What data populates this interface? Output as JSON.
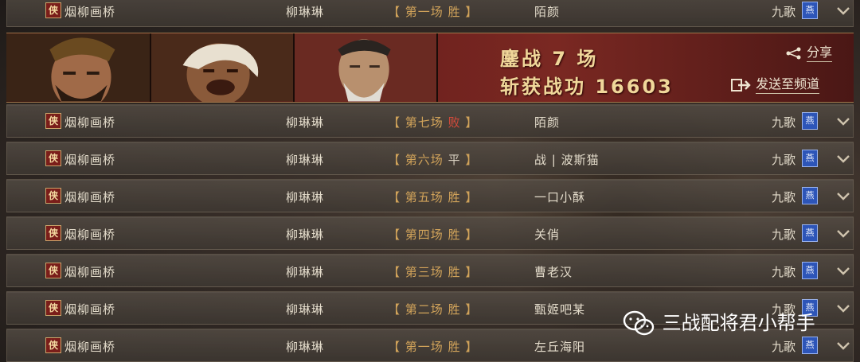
{
  "rows_top": {
    "faction": "侠",
    "player": "烟柳画桥",
    "server": "柳琳琳",
    "battle_prefix": "【",
    "battle_label": "第一场",
    "battle_result": "胜",
    "battle_suffix": "】",
    "opponent": "陌颜",
    "opponent_server": "九歌",
    "opponent_faction": "燕"
  },
  "banner": {
    "line1_label": "鏖战",
    "line1_count": "7",
    "line1_unit": "场",
    "line2_label": "斩获战功",
    "line2_value": "16603",
    "share_label": "分享",
    "send_label": "发送至频道"
  },
  "rows": [
    {
      "faction": "侠",
      "player": "烟柳画桥",
      "server": "柳琳琳",
      "battle_label": "第七场",
      "battle_result": "败",
      "opponent": "陌颜",
      "opponent_server": "九歌",
      "opponent_faction": "燕"
    },
    {
      "faction": "侠",
      "player": "烟柳画桥",
      "server": "柳琳琳",
      "battle_label": "第六场",
      "battle_result": "平",
      "opponent": "战 | 波斯猫",
      "opponent_server": "九歌",
      "opponent_faction": "燕"
    },
    {
      "faction": "侠",
      "player": "烟柳画桥",
      "server": "柳琳琳",
      "battle_label": "第五场",
      "battle_result": "胜",
      "opponent": "一口小酥",
      "opponent_server": "九歌",
      "opponent_faction": "燕"
    },
    {
      "faction": "侠",
      "player": "烟柳画桥",
      "server": "柳琳琳",
      "battle_label": "第四场",
      "battle_result": "胜",
      "opponent": "关俏",
      "opponent_server": "九歌",
      "opponent_faction": "燕"
    },
    {
      "faction": "侠",
      "player": "烟柳画桥",
      "server": "柳琳琳",
      "battle_label": "第三场",
      "battle_result": "胜",
      "opponent": "曹老汉",
      "opponent_server": "九歌",
      "opponent_faction": "燕"
    },
    {
      "faction": "侠",
      "player": "烟柳画桥",
      "server": "柳琳琳",
      "battle_label": "第二场",
      "battle_result": "胜",
      "opponent": "甄姬吧某",
      "opponent_server": "九歌",
      "opponent_faction": "燕"
    },
    {
      "faction": "侠",
      "player": "烟柳画桥",
      "server": "柳琳琳",
      "battle_label": "第一场",
      "battle_result": "胜",
      "opponent": "左丘海阳",
      "opponent_server": "九歌",
      "opponent_faction": "燕"
    }
  ],
  "battle_brackets": {
    "open": "【",
    "close": "】"
  },
  "watermark": {
    "text": "三战配将君小帮手",
    "icon": "wechat-icon"
  },
  "colors": {
    "win": "#d1a35a",
    "lose": "#d64a3a",
    "draw": "#d8d0c0",
    "faction_badge": "#7a1e1a",
    "opponent_badge": "#2d55b8",
    "banner": "#6a1f1c"
  }
}
